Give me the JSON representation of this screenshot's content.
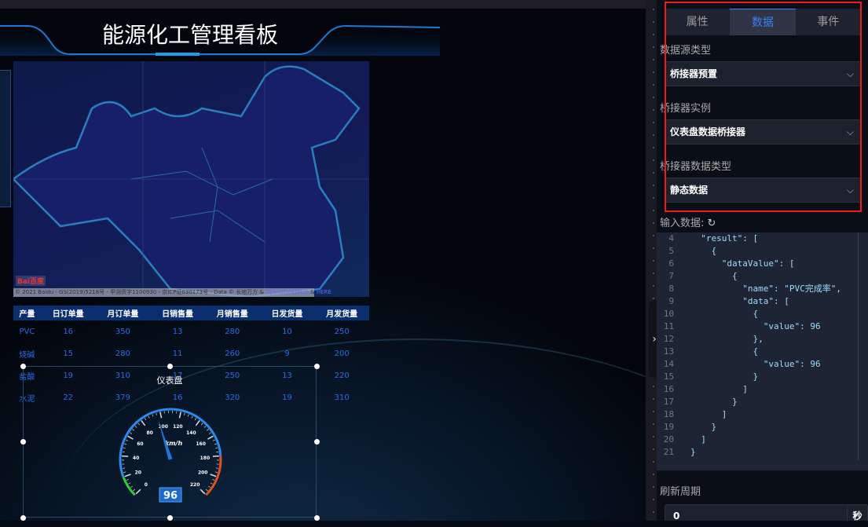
{
  "dashboard": {
    "title": "能源化工管理看板",
    "map": {
      "logo": "Bai百度地图",
      "attribution": "© 2021 Baidu - GS(2019)5218号 - 甲测资字1100930 - 京ICP证030173号 - Data © 长地万方 & ",
      "osm": "OpenStreetMap",
      "and": " & ",
      "here": "HERE"
    },
    "table": {
      "headers": [
        "产量",
        "日订单量",
        "月订单量",
        "日销售量",
        "月销售量",
        "日发货量",
        "月发货量"
      ],
      "rows": [
        [
          "PVC",
          "16",
          "350",
          "13",
          "280",
          "10",
          "250"
        ],
        [
          "烧碱",
          "15",
          "280",
          "11",
          "260",
          "9",
          "200"
        ],
        [
          "盐酸",
          "19",
          "310",
          "17",
          "250",
          "13",
          "220"
        ],
        [
          "水泥",
          "22",
          "379",
          "16",
          "320",
          "19",
          "310"
        ]
      ]
    },
    "gauge": {
      "title": "仪表盘",
      "unit": "km/h",
      "value": 96,
      "min": 0,
      "max": 220,
      "ticks": [
        "0",
        "20",
        "40",
        "60",
        "80",
        "100",
        "120",
        "140",
        "160",
        "180",
        "200",
        "220"
      ]
    }
  },
  "panel": {
    "tabs": [
      "属性",
      "数据",
      "事件"
    ],
    "active_tab": "数据",
    "fields": [
      {
        "label": "数据源类型",
        "value": "桥接器预置"
      },
      {
        "label": "桥接器实例",
        "value": "仪表盘数据桥接器"
      },
      {
        "label": "桥接器数据类型",
        "value": "静态数据"
      }
    ],
    "input_label": "输入数据:",
    "refresh_icon": "refresh-icon",
    "code_lines": [
      {
        "n": "4",
        "t": "  \"result\": ["
      },
      {
        "n": "5",
        "t": "    {"
      },
      {
        "n": "6",
        "t": "      \"dataValue\": ["
      },
      {
        "n": "7",
        "t": "        {"
      },
      {
        "n": "8",
        "t": "          \"name\": \"PVC完成率\","
      },
      {
        "n": "9",
        "t": "          \"data\": ["
      },
      {
        "n": "10",
        "t": "            {"
      },
      {
        "n": "11",
        "t": "              \"value\": 96"
      },
      {
        "n": "12",
        "t": "            },"
      },
      {
        "n": "13",
        "t": "            {"
      },
      {
        "n": "14",
        "t": "              \"value\": 96"
      },
      {
        "n": "15",
        "t": "            }"
      },
      {
        "n": "16",
        "t": "          ]"
      },
      {
        "n": "17",
        "t": "        }"
      },
      {
        "n": "18",
        "t": "      ]"
      },
      {
        "n": "19",
        "t": "    }"
      },
      {
        "n": "20",
        "t": "  ]"
      },
      {
        "n": "21",
        "t": "}"
      }
    ],
    "refresh_label": "刷新周期",
    "refresh_value": "0",
    "refresh_unit": "秒"
  },
  "colors": {
    "accent": "#3b82f6",
    "highlight": "#f01a1a",
    "table_text": "#2a6af0"
  }
}
